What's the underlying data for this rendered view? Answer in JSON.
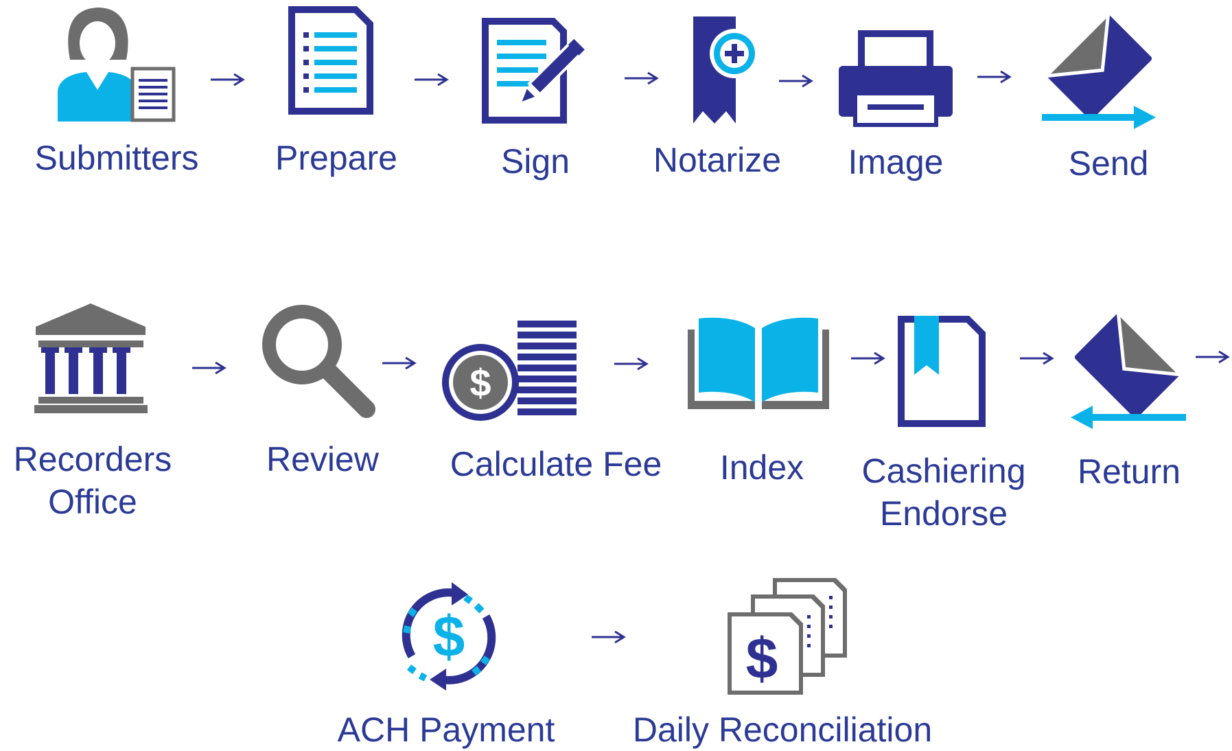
{
  "colors": {
    "navy": "#2e3191",
    "cyan": "#0ab2e8",
    "gray": "#6d6d6d",
    "label": "#2b3a96"
  },
  "rows": [
    {
      "steps": [
        {
          "label": "Submitters",
          "icon": "person-document-icon"
        },
        {
          "label": "Prepare",
          "icon": "document-list-icon"
        },
        {
          "label": "Sign",
          "icon": "pen-document-icon"
        },
        {
          "label": "Notarize",
          "icon": "notary-ribbon-icon"
        },
        {
          "label": "Image",
          "icon": "printer-icon"
        },
        {
          "label": "Send",
          "icon": "envelope-send-icon"
        }
      ]
    },
    {
      "steps": [
        {
          "label": "Recorders Office",
          "icon": "government-building-icon"
        },
        {
          "label": "Review",
          "icon": "magnifying-glass-icon"
        },
        {
          "label": "Calculate Fee",
          "icon": "coin-stack-icon"
        },
        {
          "label": "Index",
          "icon": "open-book-icon"
        },
        {
          "label": "Cashiering Endorse",
          "icon": "bookmark-document-icon"
        },
        {
          "label": "Return",
          "icon": "envelope-return-icon"
        }
      ]
    },
    {
      "steps": [
        {
          "label": "ACH Payment",
          "icon": "payment-cycle-icon"
        },
        {
          "label": "Daily Reconciliation",
          "icon": "stacked-documents-icon"
        }
      ]
    }
  ]
}
